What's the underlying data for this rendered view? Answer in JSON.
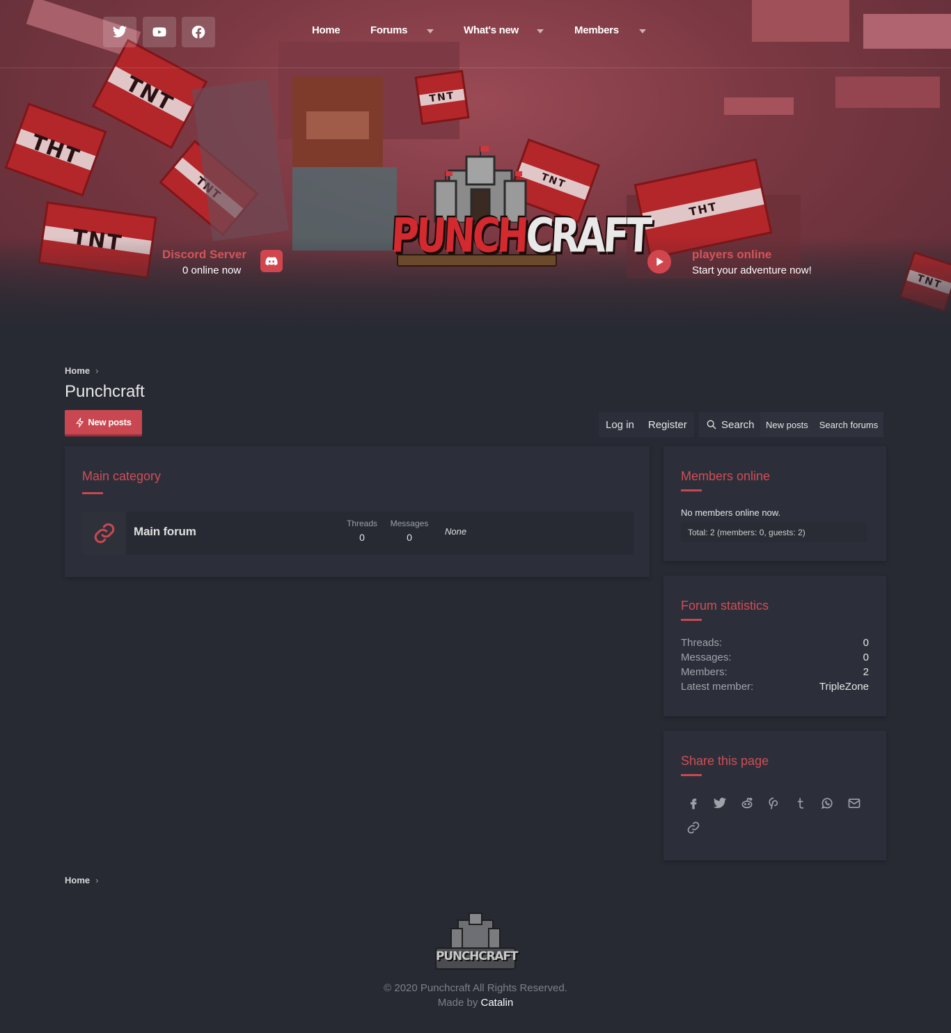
{
  "social": [
    {
      "name": "twitter-icon"
    },
    {
      "name": "youtube-icon"
    },
    {
      "name": "facebook-icon"
    }
  ],
  "nav": {
    "home": "Home",
    "forums": "Forums",
    "whats_new": "What's new",
    "members": "Members"
  },
  "hero": {
    "logo_text_a": "PUNCH",
    "logo_text_b": "CRAFT",
    "discord_title": "Discord Server",
    "discord_sub": "0 online now",
    "players_title": "players online",
    "players_sub": "Start your adventure now!"
  },
  "breadcrumb": {
    "home": "Home"
  },
  "page": {
    "title": "Punchcraft",
    "new_posts_button": "New posts"
  },
  "account": {
    "login": "Log in",
    "register": "Register",
    "search": "Search",
    "new_posts": "New posts",
    "search_forums": "Search forums"
  },
  "category": {
    "title": "Main category",
    "forums": [
      {
        "name": "Main forum",
        "threads_label": "Threads",
        "threads": "0",
        "messages_label": "Messages",
        "messages": "0",
        "latest": "None"
      }
    ]
  },
  "members_online": {
    "title": "Members online",
    "text": "No members online now.",
    "total": "Total: 2 (members: 0, guests: 2)"
  },
  "forum_statistics": {
    "title": "Forum statistics",
    "rows": [
      {
        "k": "Threads:",
        "v": "0"
      },
      {
        "k": "Messages:",
        "v": "0"
      },
      {
        "k": "Members:",
        "v": "2"
      },
      {
        "k": "Latest member:",
        "v": "TripleZone"
      }
    ]
  },
  "share": {
    "title": "Share this page",
    "icons": [
      "facebook-icon",
      "twitter-icon",
      "reddit-icon",
      "pinterest-icon",
      "tumblr-icon",
      "whatsapp-icon",
      "email-icon",
      "link-icon"
    ]
  },
  "footer": {
    "logo_text": "PUNCHCRAFT",
    "copyright": "© 2020 Punchcraft All Rights Reserved.",
    "made_by_prefix": "Made by",
    "made_by_name": "Catalin"
  },
  "colors": {
    "accent": "#c94750",
    "background": "#272a33",
    "panel": "#2c2f39"
  }
}
